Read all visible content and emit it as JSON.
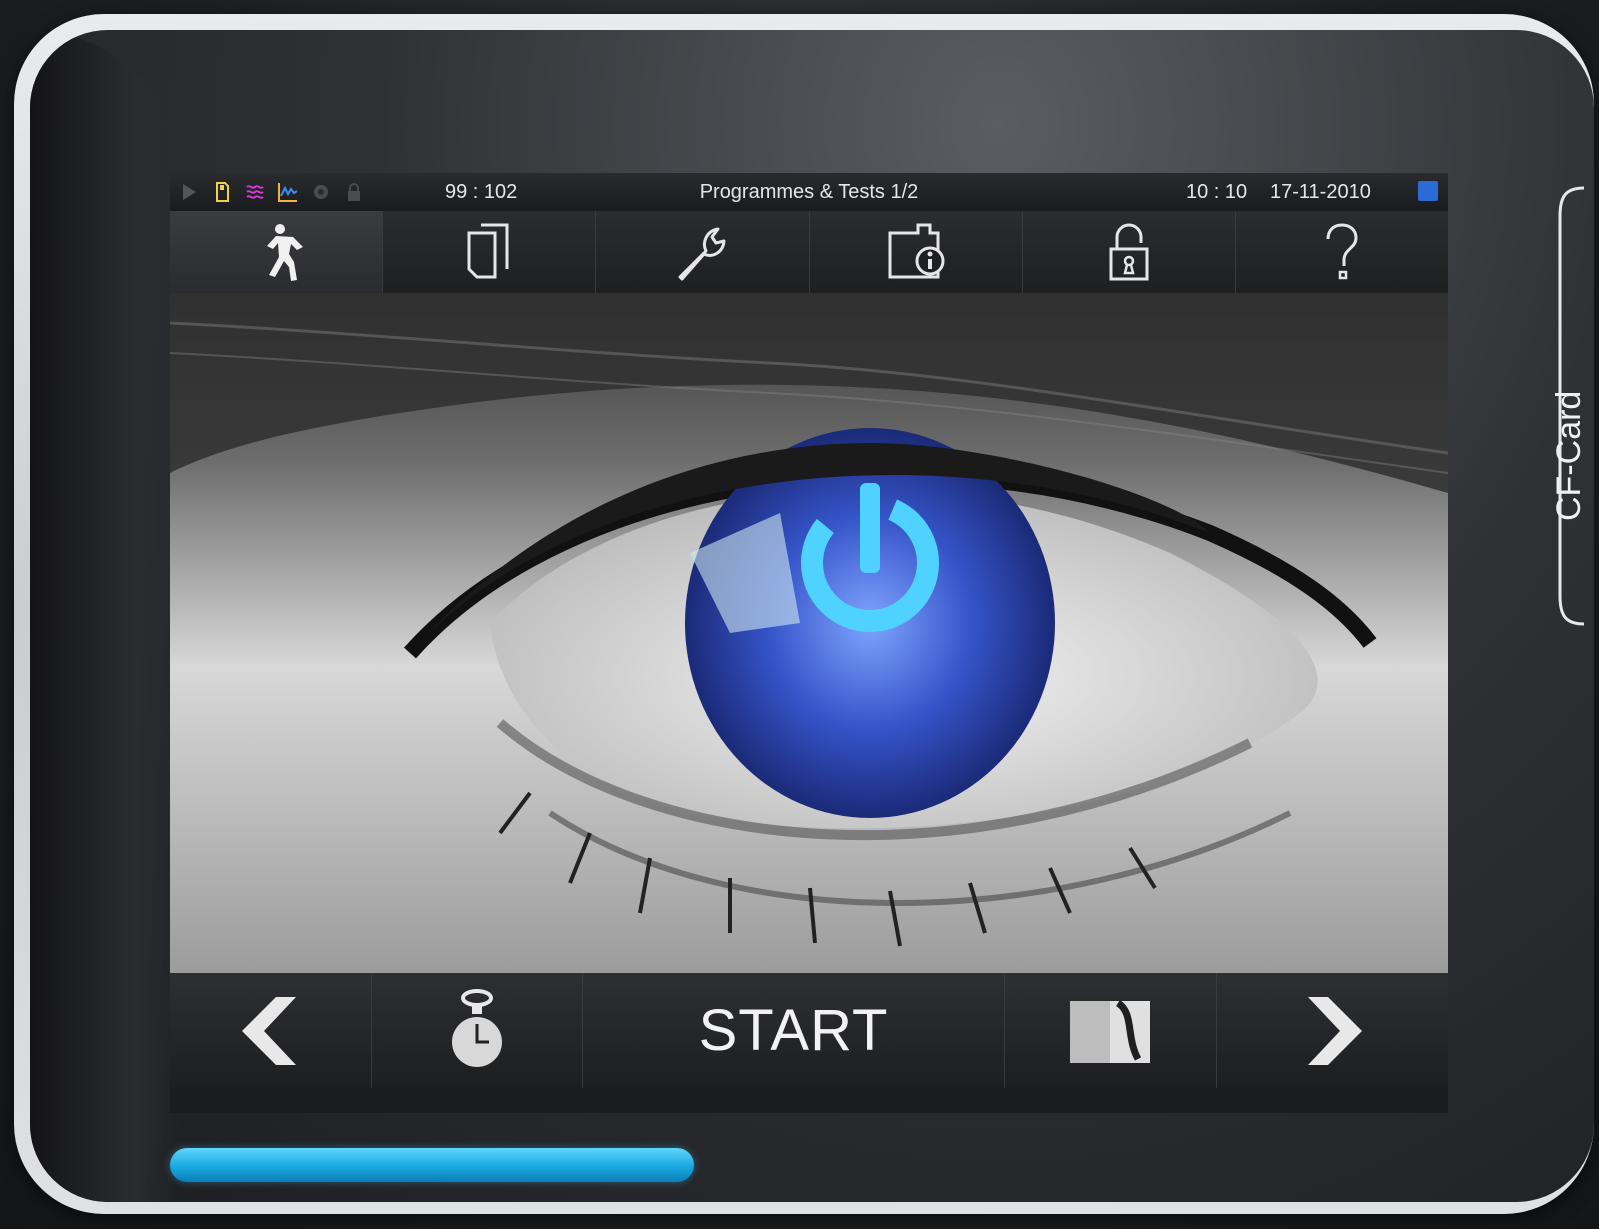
{
  "statusbar": {
    "counter": "99 : 102",
    "title": "Programmes & Tests 1/2",
    "time": "10 : 10",
    "date": "17-11-2010",
    "icons": [
      "play-icon",
      "memory-card-icon",
      "steam-waves-icon",
      "graph-icon",
      "gear-cog-icon",
      "lock-icon"
    ],
    "status_color": "#2c6ad6"
  },
  "toptabs": [
    {
      "name": "programme-start-tab",
      "icon": "running-man-icon",
      "active": true
    },
    {
      "name": "log-documents-tab",
      "icon": "documents-icon",
      "active": false
    },
    {
      "name": "maintenance-tab",
      "icon": "wrench-icon",
      "active": false
    },
    {
      "name": "info-tab",
      "icon": "folder-info-icon",
      "active": false
    },
    {
      "name": "unlock-tab",
      "icon": "unlock-icon",
      "active": false
    },
    {
      "name": "help-tab",
      "icon": "question-mark-icon",
      "active": false
    }
  ],
  "main": {
    "image": "eye-with-power-symbol",
    "accent_color": "#3a6cff"
  },
  "bottombar": {
    "prev_icon": "chevron-left-icon",
    "timer_icon": "stopwatch-icon",
    "start_label": "START",
    "card_icon": "card-eject-icon",
    "next_icon": "chevron-right-icon"
  },
  "progress": {
    "fraction": 0.41,
    "color": "#19a8e0"
  },
  "side": {
    "cf_label": "CF-Card"
  }
}
